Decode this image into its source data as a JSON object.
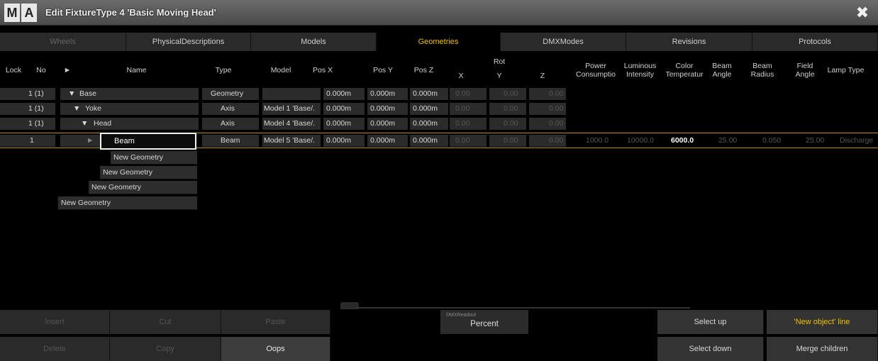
{
  "window": {
    "logo_m": "M",
    "logo_a": "A",
    "title": "Edit FixtureType 4 'Basic Moving Head'",
    "close_glyph": "✖"
  },
  "tabs": [
    {
      "label": "Wheels",
      "state": "dim"
    },
    {
      "label": "PhysicalDescriptions",
      "state": "normal"
    },
    {
      "label": "Models",
      "state": "normal"
    },
    {
      "label": "Geometries",
      "state": "active"
    },
    {
      "label": "DMXModes",
      "state": "normal"
    },
    {
      "label": "Revisions",
      "state": "normal"
    },
    {
      "label": "Protocols",
      "state": "normal"
    }
  ],
  "columns": {
    "lock": "Lock",
    "no": "No",
    "expand": "►",
    "name": "Name",
    "type": "Type",
    "model": "Model",
    "pos_x": "Pos X",
    "pos_y": "Pos Y",
    "pos_z": "Pos Z",
    "rot_x": "X",
    "rot_group": "Rot",
    "rot_y": "Y",
    "rot_z": "Z",
    "power": "Power Consumptio",
    "luminous": "Luminous Intensity",
    "color_temp": "Color Temperatur",
    "beam_angle": "Beam Angle",
    "beam_radius": "Beam Radius",
    "field_angle": "Field Angle",
    "lamp_type": "Lamp Type"
  },
  "rows": [
    {
      "no": "1 (1)",
      "tri": "▼",
      "name": "Base",
      "type": "Geometry",
      "model": "",
      "pos_x": "0.000m",
      "pos_y": "0.000m",
      "pos_z": "0.000m",
      "rot_x": "0.00",
      "rot_y": "0.00",
      "rot_z": "0.00"
    },
    {
      "no": "1 (1)",
      "tri": "▼",
      "name": "Yoke",
      "type": "Axis",
      "model": "Model 1 'Base/.",
      "pos_x": "0.000m",
      "pos_y": "0.000m",
      "pos_z": "0.000m",
      "rot_x": "0.00",
      "rot_y": "0.00",
      "rot_z": "0.00"
    },
    {
      "no": "1 (1)",
      "tri": "▼",
      "name": "Head",
      "type": "Axis",
      "model": "Model 4 'Base/.",
      "pos_x": "0.000m",
      "pos_y": "0.000m",
      "pos_z": "0.000m",
      "rot_x": "0.00",
      "rot_y": "0.00",
      "rot_z": "0.00"
    }
  ],
  "selected_row": {
    "no": "1",
    "tri": "►",
    "name": "Beam",
    "type": "Beam",
    "model": "Model 5 'Base/.",
    "pos_x": "0.000m",
    "pos_y": "0.000m",
    "pos_z": "0.000m",
    "rot_x": "0.00",
    "rot_y": "0.00",
    "rot_z": "0.00",
    "power": "1000.0",
    "luminous": "10000.0",
    "color_temp": "6000.0",
    "beam_angle": "25.00",
    "beam_radius": "0.050",
    "field_angle": "25.00",
    "lamp_type": "Discharge"
  },
  "new_geometry_items": [
    "New Geometry",
    "New Geometry",
    "New Geometry",
    "New Geometry"
  ],
  "toolbar": {
    "insert": "Insert",
    "cut": "Cut",
    "paste": "Paste",
    "delete": "Delete",
    "copy": "Copy",
    "oops": "Oops",
    "dmx_caption": "DMXReadout",
    "dmx_value": "Percent",
    "select_up": "Select up",
    "select_down": "Select down",
    "new_object_line": "'New object' line",
    "merge_children": "Merge children"
  },
  "colors": {
    "accent": "#f0c000",
    "tab_bg": "#2a2a2a",
    "background": "#000000"
  }
}
